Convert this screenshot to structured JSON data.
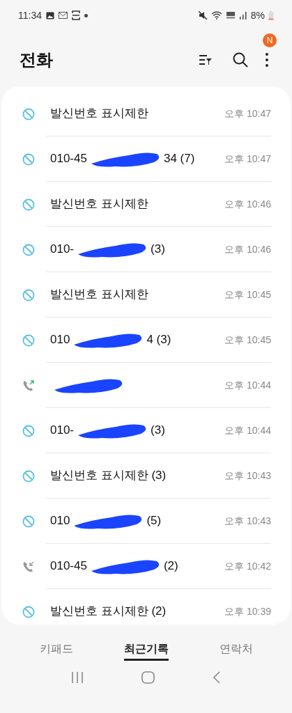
{
  "status_bar": {
    "time": "11:34",
    "battery": "8%"
  },
  "header": {
    "title": "전화",
    "badge": "N"
  },
  "calls": [
    {
      "kind": "blocked",
      "name": "발신번호 표시제한",
      "time": "오후 10:47"
    },
    {
      "kind": "blocked",
      "name": "010-45",
      "redacted": true,
      "name_after": "34 (7)",
      "time": "오후 10:47"
    },
    {
      "kind": "blocked",
      "name": "발신번호 표시제한",
      "time": "오후 10:46"
    },
    {
      "kind": "blocked",
      "name": "010-",
      "redacted": true,
      "name_after": "(3)",
      "time": "오후 10:46"
    },
    {
      "kind": "blocked",
      "name": "발신번호 표시제한",
      "time": "오후 10:45"
    },
    {
      "kind": "blocked",
      "name": "010",
      "redacted": true,
      "name_after": "4 (3)",
      "time": "오후 10:45"
    },
    {
      "kind": "outgoing",
      "redacted": true,
      "time": "오후 10:44"
    },
    {
      "kind": "blocked",
      "name": "010-",
      "redacted": true,
      "name_after": "(3)",
      "time": "오후 10:44"
    },
    {
      "kind": "blocked",
      "name": "발신번호 표시제한 (3)",
      "time": "오후 10:43"
    },
    {
      "kind": "blocked",
      "name": "010",
      "redacted": true,
      "name_after": "(5)",
      "time": "오후 10:43"
    },
    {
      "kind": "incoming",
      "name": "010-45",
      "redacted": true,
      "name_after": "(2)",
      "time": "오후 10:42"
    },
    {
      "kind": "blocked",
      "name": "발신번호 표시제한 (2)",
      "time": "오후 10:39"
    }
  ],
  "tabs": [
    {
      "label": "키패드",
      "selected": false
    },
    {
      "label": "최근기록",
      "selected": true
    },
    {
      "label": "연락처",
      "selected": false
    }
  ]
}
